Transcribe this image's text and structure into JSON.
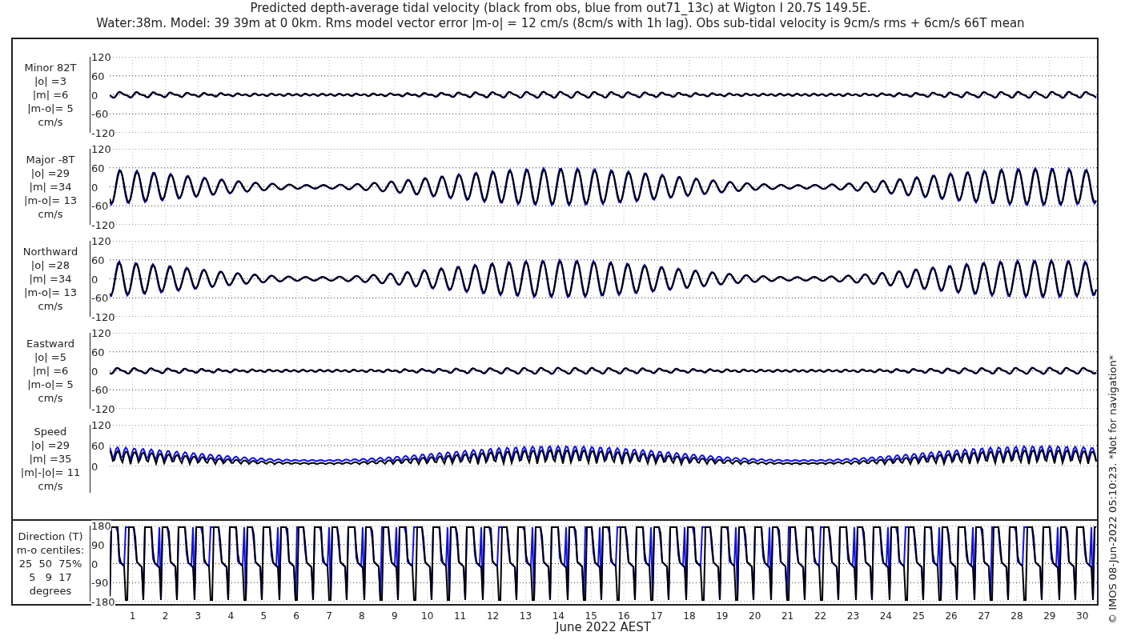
{
  "title_lines": [
    "Predicted depth-average tidal velocity (black from obs, blue from out71_13c) at Wigton I 20.7S 149.5E.",
    "Water:38m. Model: 39 39m at 0 0km. Rms model vector error |m-o| = 12 cm/s (8cm/s with 1h lag). Obs sub-tidal velocity is 9cm/s rms + 6cm/s 66T mean"
  ],
  "panels": [
    {
      "kind": "velocity",
      "label_lines": [
        "Minor 82T",
        "|o| =3",
        "|m| =6",
        "|m-o|= 5",
        "cm/s"
      ],
      "yticks": [
        "120",
        "60",
        "0",
        "-60",
        "-120"
      ]
    },
    {
      "kind": "velocity",
      "label_lines": [
        "Major -8T",
        "|o| =29",
        "|m| =34",
        "|m-o|= 13",
        "cm/s"
      ],
      "yticks": [
        "120",
        "60",
        "0",
        "-60",
        "-120"
      ]
    },
    {
      "kind": "velocity",
      "label_lines": [
        "Northward",
        "|o| =28",
        "|m| =34",
        "|m-o|= 13",
        "cm/s"
      ],
      "yticks": [
        "120",
        "60",
        "0",
        "-60",
        "-120"
      ]
    },
    {
      "kind": "velocity",
      "label_lines": [
        "Eastward",
        "|o| =5",
        "|m| =6",
        "|m-o|= 5",
        "cm/s"
      ],
      "yticks": [
        "120",
        "60",
        "0",
        "-60",
        "-120"
      ]
    },
    {
      "kind": "speed",
      "label_lines": [
        "Speed",
        "|o| =29",
        "|m| =35",
        "|m|-|o|= 11",
        "cm/s"
      ],
      "yticks": [
        "120",
        "60",
        "0"
      ]
    },
    {
      "kind": "direction",
      "label_lines": [
        "Direction (T)",
        "m-o centiles:",
        "25  50  75%",
        "5   9  17",
        "degrees"
      ],
      "yticks": [
        "180",
        "90",
        "0",
        "-90",
        "-180"
      ]
    }
  ],
  "xticks": [
    "1",
    "2",
    "3",
    "4",
    "5",
    "6",
    "7",
    "8",
    "9",
    "10",
    "11",
    "12",
    "13",
    "14",
    "15",
    "16",
    "17",
    "18",
    "19",
    "20",
    "21",
    "22",
    "23",
    "24",
    "25",
    "26",
    "27",
    "28",
    "29",
    "30"
  ],
  "xlabel": "June 2022 AEST",
  "credit": "© IMOS 08-Jun-2022 05:10:23. *Not for navigation*"
}
